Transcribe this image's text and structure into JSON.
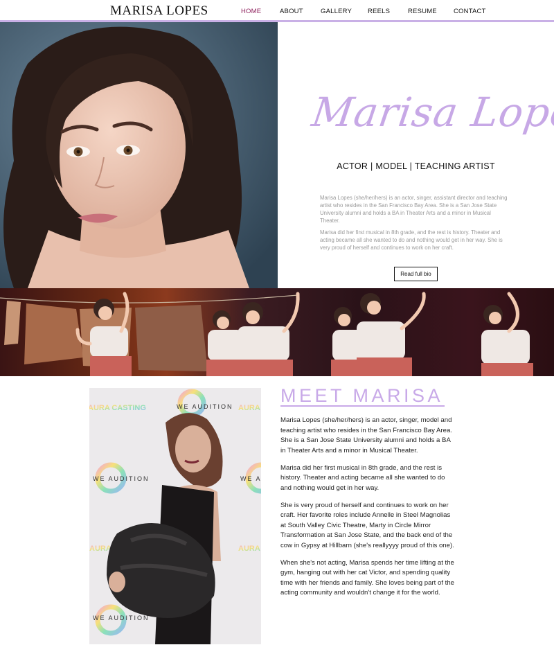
{
  "header": {
    "logo": "MARISA LOPES",
    "nav": [
      {
        "label": "HOME",
        "active": true
      },
      {
        "label": "ABOUT",
        "active": false
      },
      {
        "label": "GALLERY",
        "active": false
      },
      {
        "label": "REELS",
        "active": false
      },
      {
        "label": "RESUME",
        "active": false
      },
      {
        "label": "CONTACT",
        "active": false
      }
    ]
  },
  "hero": {
    "signature": "Marisa Lopes",
    "tagline": "ACTOR | MODEL | TEACHING ARTIST",
    "bio_paragraphs": [
      "Marisa Lopes (she/her/hers) is an actor, singer, assistant director and teaching artist who resides in the San Francisco Bay Area. She is a San Jose State University alumni and holds a BA in Theater Arts and a minor in Musical Theater.",
      "Marisa did her first musical in 8th grade, and the rest is history. Theater and acting became all she wanted to do and nothing would get in her way. She is very proud of herself and continues to work on her craft."
    ],
    "read_bio_label": "Read full bio"
  },
  "photo_wall": {
    "logos": [
      "AURA CASTING",
      "WE AUDITION"
    ]
  },
  "meet": {
    "title": "MEET MARISA",
    "paragraphs": [
      "Marisa Lopes (she/her/hers) is an actor, singer, model and teaching artist who resides in the San Francisco Bay Area. She is a San Jose State University alumni and holds a BA in Theater Arts and a minor in Musical Theater.",
      "Marisa did her first musical in 8th grade, and the rest is history. Theater and acting became all she wanted to do and nothing would get in her way.",
      "She is very proud of herself and continues to work on her craft. Her favorite roles include Annelle in Steel Magnolias at South Valley Civic Theatre, Marty in Circle Mirror Transformation at San Jose State, and the back end of the cow in Gypsy at Hillbarn (she's reallyyyy proud of this one).",
      "When she's not acting, Marisa spends her time lifting at the gym, hanging out with her cat Victor, and spending quality time with her friends and family. She loves being part of the acting community and wouldn't change it for the world."
    ]
  },
  "colors": {
    "accent_lavender": "#c8a9e8",
    "nav_active": "#8d1f5c",
    "text_muted": "#9a9a9a"
  }
}
